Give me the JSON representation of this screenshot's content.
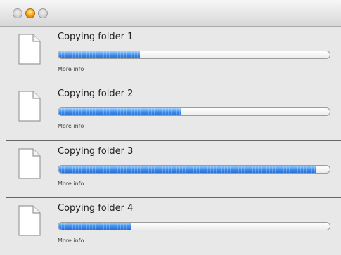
{
  "window": {
    "controls": {
      "close": "close-button",
      "minimize": "minimize-button",
      "zoom": "zoom-button"
    }
  },
  "transfers": [
    {
      "title": "Copying folder 1",
      "progress": 0.3,
      "more_info": "More info",
      "icon": "document-icon"
    },
    {
      "title": "Copying folder 2",
      "progress": 0.45,
      "more_info": "More info",
      "icon": "document-icon"
    },
    {
      "title": "Copying folder 3",
      "progress": 0.95,
      "more_info": "More info",
      "icon": "document-icon"
    },
    {
      "title": "Copying folder 4",
      "progress": 0.27,
      "more_info": "More info",
      "icon": "document-icon"
    }
  ]
}
